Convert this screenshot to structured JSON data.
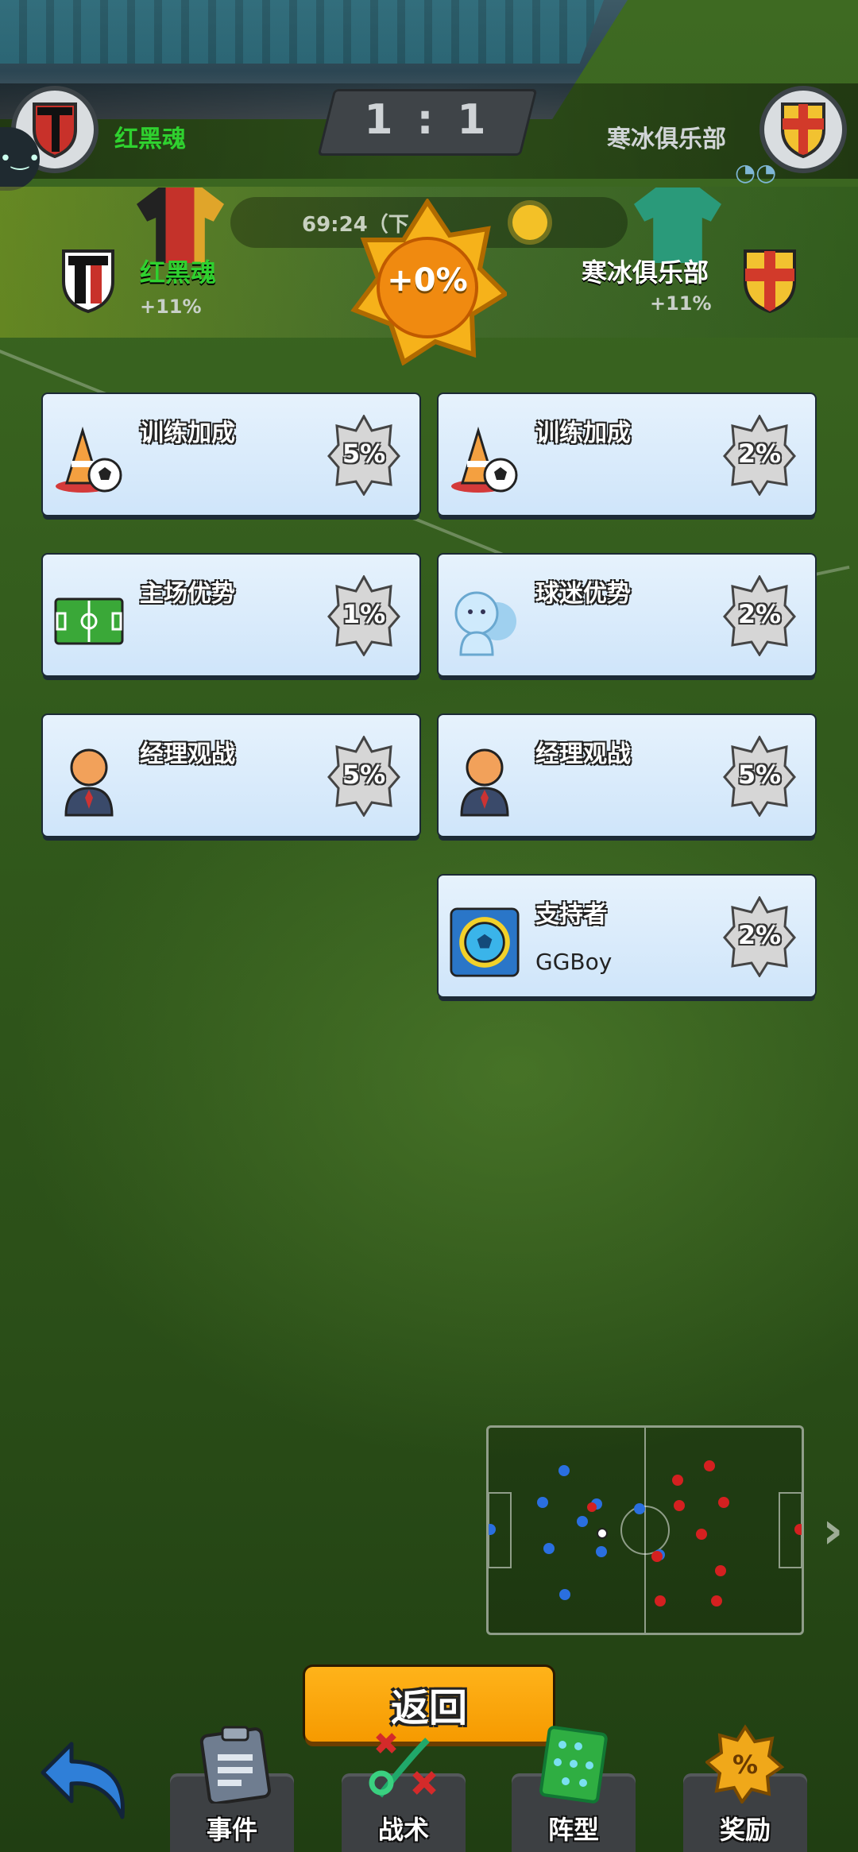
{
  "scoreboard": {
    "home_name": "红黑魂",
    "away_name": "寒冰俱乐部",
    "home_score": "1",
    "separator": ":",
    "away_score": "1"
  },
  "summary": {
    "time": "69:24（下",
    "total_bonus": "+0%",
    "home_name": "红黑魂",
    "home_pct": "+11%",
    "away_name": "寒冰俱乐部",
    "away_pct": "+11%",
    "home_color": "#d62828",
    "away_color": "#2a9a7a"
  },
  "cards": {
    "left": [
      {
        "title": "训练加成",
        "value": "5%",
        "icon": "training-cone-icon"
      },
      {
        "title": "主场优势",
        "value": "1%",
        "icon": "pitch-icon"
      },
      {
        "title": "经理观战",
        "value": "5%",
        "icon": "manager-icon"
      }
    ],
    "right": [
      {
        "title": "训练加成",
        "value": "2%",
        "icon": "training-cone-icon"
      },
      {
        "title": "球迷优势",
        "value": "2%",
        "icon": "fans-icon"
      },
      {
        "title": "经理观战",
        "value": "5%",
        "icon": "manager-icon"
      },
      {
        "title": "支持者",
        "subtitle": "GGBoy",
        "value": "2%",
        "icon": "supporter-ball-icon"
      }
    ]
  },
  "actions": {
    "back_label": "返回"
  },
  "nav": {
    "events": "事件",
    "tactics": "战术",
    "formation": "阵型",
    "rewards": "奖励"
  },
  "colors": {
    "accent_orange": "#f69a00",
    "card_bg": "#cfe5fa",
    "home_dot": "#2a6fe0",
    "away_dot": "#d42020"
  }
}
